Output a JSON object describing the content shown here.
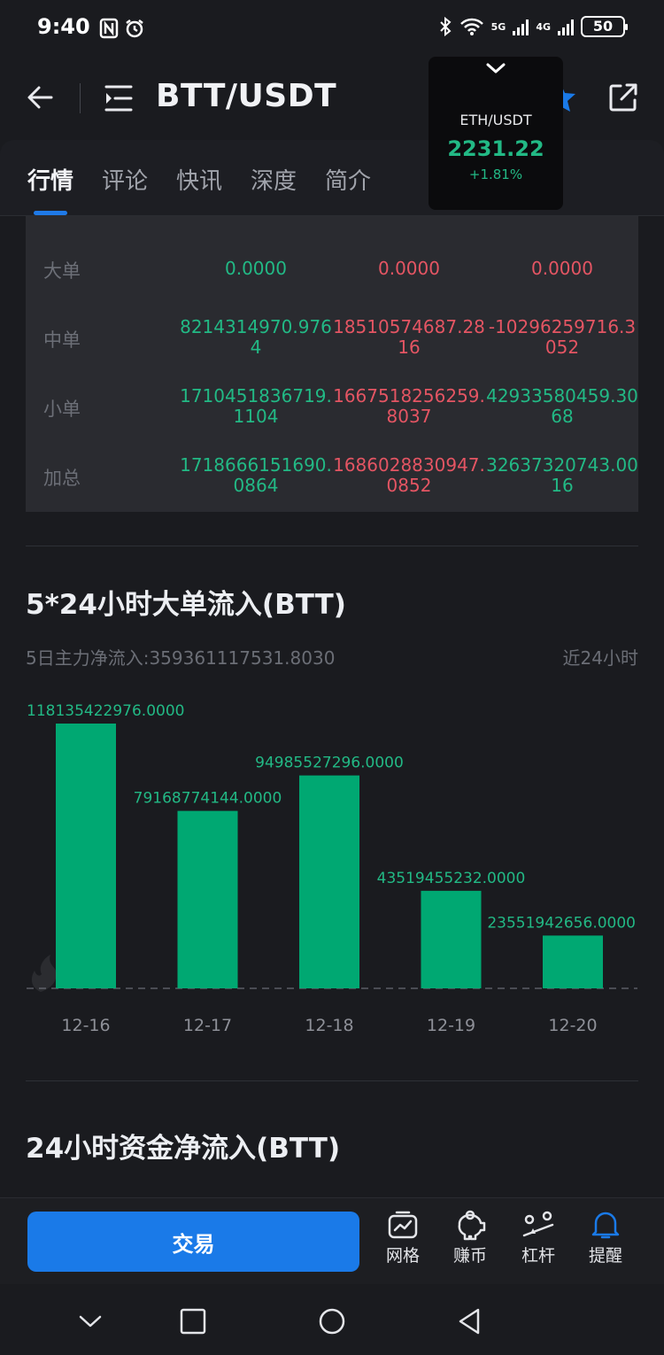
{
  "status_bar": {
    "time": "9:40",
    "net1": "5G",
    "net2": "4G",
    "battery": "50"
  },
  "header": {
    "title": "BTT/USDT"
  },
  "ticker": {
    "pair": "ETH/USDT",
    "price": "2231.22",
    "change": "+1.81%"
  },
  "tabs": [
    {
      "label": "行情",
      "active": true
    },
    {
      "label": "评论",
      "active": false
    },
    {
      "label": "快讯",
      "active": false
    },
    {
      "label": "深度",
      "active": false
    },
    {
      "label": "简介",
      "active": false
    }
  ],
  "flow_table": {
    "rows": [
      {
        "label": "大单",
        "inflow": "0.0000",
        "outflow": "0.0000",
        "net": "0.0000"
      },
      {
        "label": "中单",
        "inflow": "8214314970.9764",
        "outflow": "18510574687.2816",
        "net": "-10296259716.3052"
      },
      {
        "label": "小单",
        "inflow": "1710451836719.1104",
        "outflow": "1667518256259.8037",
        "net": "42933580459.3068"
      },
      {
        "label": "加总",
        "inflow": "1718666151690.0864",
        "outflow": "1686028830947.0852",
        "net": "32637320743.0016"
      }
    ]
  },
  "large_order_section": {
    "title": "5*24小时大单流入(BTT)",
    "net_inflow": "5日主力净流入:359361117531.8030",
    "period": "近24小时"
  },
  "chart_data": {
    "type": "bar",
    "categories": [
      "12-16",
      "12-17",
      "12-18",
      "12-19",
      "12-20"
    ],
    "values": [
      118135422976.0,
      79168774144.0,
      94985527296.0,
      43519455232.0,
      23551942656.0
    ],
    "value_labels": [
      "118135422976.0000",
      "79168774144.0000",
      "94985527296.0000",
      "43519455232.0000",
      "23551942656.0000"
    ],
    "bar_color": "#00a872",
    "ylim": [
      0,
      118135422976
    ]
  },
  "net_section": {
    "title": "24小时资金净流入(BTT)"
  },
  "bottom_bar": {
    "trade_label": "交易",
    "tools": [
      {
        "name": "grid",
        "label": "网格"
      },
      {
        "name": "earn",
        "label": "赚币"
      },
      {
        "name": "leverage",
        "label": "杠杆"
      },
      {
        "name": "alert",
        "label": "提醒"
      }
    ]
  },
  "colors": {
    "green": "#22b985",
    "red": "#e45563",
    "accent": "#1a7ae8",
    "bar": "#00a872"
  }
}
